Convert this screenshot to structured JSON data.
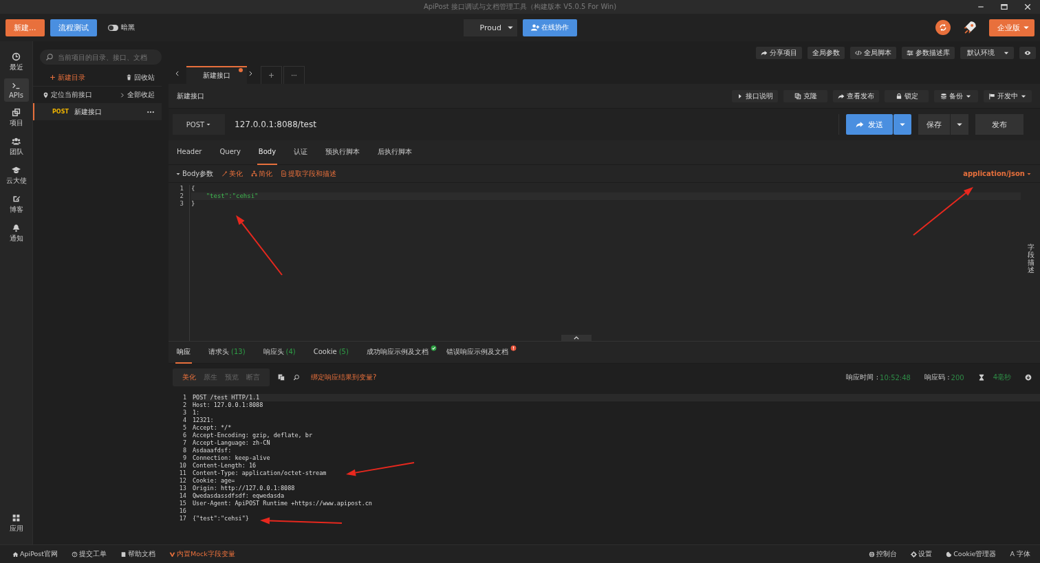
{
  "window": {
    "title": "ApiPost 接口调试与文档管理工具（构建版本 V5.0.5 For Win)"
  },
  "toolbar": {
    "new_button": "新建...",
    "flow_button": "流程测试",
    "dark_toggle": {
      "label": "暗黑",
      "on": false
    },
    "team_select": "Proud",
    "collab_button": "在线协作",
    "edition_button": "企业版"
  },
  "rail": [
    {
      "label": "最近",
      "kind": "clock",
      "selected": false
    },
    {
      "label": "APIs",
      "kind": "terminal",
      "selected": true
    },
    {
      "label": "项目",
      "kind": "windows",
      "selected": false
    },
    {
      "label": "团队",
      "kind": "users",
      "selected": false
    },
    {
      "label": "云大使",
      "kind": "cap",
      "selected": false
    },
    {
      "label": "博客",
      "kind": "edit",
      "selected": false
    },
    {
      "label": "通知",
      "kind": "bell",
      "selected": false
    }
  ],
  "rail_bottom": {
    "label": "应用",
    "kind": "grid"
  },
  "sidebar": {
    "search_placeholder": "当前项目的目录、接口、文档",
    "new_folder": "新建目录",
    "trash": "回收站",
    "locate": "定位当前接口",
    "collapse": "全部收起",
    "items": [
      {
        "method": "POST",
        "name": "新建接口",
        "selected": true
      }
    ]
  },
  "global_actions": [
    "分享项目",
    "全局参数",
    "全局脚本",
    "参数描述库"
  ],
  "environment": "默认环境",
  "tabs": [
    {
      "label": "新建接口",
      "selected": true,
      "unsaved": true
    }
  ],
  "api_name": "新建接口",
  "api_actions": [
    {
      "label": "接口说明",
      "kind": "play",
      "dropdown": false
    },
    {
      "label": "克隆",
      "kind": "copy",
      "dropdown": false
    },
    {
      "label": "查看发布",
      "kind": "share",
      "dropdown": false
    },
    {
      "label": "锁定",
      "kind": "lock",
      "dropdown": false
    },
    {
      "label": "备份",
      "kind": "db",
      "dropdown": true
    },
    {
      "label": "开发中",
      "kind": "flag",
      "dropdown": true
    }
  ],
  "request": {
    "method": "POST",
    "url": "127.0.0.1:8088/test",
    "send": "发送",
    "save": "保存",
    "publish": "发布"
  },
  "request_tabs": [
    {
      "label": "Header",
      "selected": false
    },
    {
      "label": "Query",
      "selected": false
    },
    {
      "label": "Body",
      "selected": true
    },
    {
      "label": "认证",
      "selected": false
    },
    {
      "label": "预执行脚本",
      "selected": false
    },
    {
      "label": "后执行脚本",
      "selected": false
    }
  ],
  "body_bar": {
    "label": "Body参数",
    "actions": [
      "美化",
      "简化",
      "提取字段和描述"
    ],
    "content_type": "application/json"
  },
  "body_lines": [
    {
      "no": "1",
      "text": "{",
      "kind": "plain"
    },
    {
      "no": "2",
      "text": "    \"test\":\"cehsi\"",
      "kind": "string"
    },
    {
      "no": "3",
      "text": "}",
      "kind": "plain"
    }
  ],
  "side_tab": "字段描述",
  "response_tabs": [
    {
      "label": "响应",
      "kind": "plain",
      "selected": true
    },
    {
      "label": "请求头",
      "count": "(13)",
      "kind": "plain",
      "selected": false
    },
    {
      "label": "响应头",
      "count": "(4)",
      "kind": "plain",
      "selected": false
    },
    {
      "label": "Cookie",
      "count": "(5)",
      "kind": "plain",
      "selected": false
    },
    {
      "label": "成功响应示例及文档",
      "kind": "ok",
      "selected": false
    },
    {
      "label": "错误响应示例及文档",
      "kind": "error",
      "selected": false
    }
  ],
  "view_modes": [
    {
      "label": "美化",
      "selected": true
    },
    {
      "label": "原生",
      "selected": false
    },
    {
      "label": "预览",
      "selected": false
    },
    {
      "label": "断言",
      "selected": false
    }
  ],
  "bind_link": "绑定响应结果到变量?",
  "response_meta": {
    "time_label": "响应时间 :",
    "time": "10:52:48",
    "code_label": "响应码 :",
    "code": "200",
    "duration": "4毫秒"
  },
  "response_lines": [
    {
      "no": "1",
      "text": "POST /test HTTP/1.1"
    },
    {
      "no": "2",
      "text": "Host: 127.0.0.1:8088"
    },
    {
      "no": "3",
      "text": "1:"
    },
    {
      "no": "4",
      "text": "12321:"
    },
    {
      "no": "5",
      "text": "Accept: */*"
    },
    {
      "no": "6",
      "text": "Accept-Encoding: gzip, deflate, br"
    },
    {
      "no": "7",
      "text": "Accept-Language: zh-CN"
    },
    {
      "no": "8",
      "text": "Asdaaafdsf:"
    },
    {
      "no": "9",
      "text": "Connection: keep-alive"
    },
    {
      "no": "10",
      "text": "Content-Length: 16"
    },
    {
      "no": "11",
      "text": "Content-Type: application/octet-stream"
    },
    {
      "no": "12",
      "text": "Cookie: age="
    },
    {
      "no": "13",
      "text": "Origin: http://127.0.0.1:8088"
    },
    {
      "no": "14",
      "text": "Qwedasdassdfsdf: eqwedasda"
    },
    {
      "no": "15",
      "text": "User-Agent: ApiPOST Runtime +https://www.apipost.cn"
    },
    {
      "no": "16"
    },
    {
      "no": "17",
      "text": "{\"test\":\"cehsi\"}"
    }
  ],
  "footer_left": [
    {
      "label": "ApiPost官网",
      "kind": "home",
      "accent": false
    },
    {
      "label": "提交工单",
      "kind": "help",
      "accent": false
    },
    {
      "label": "帮助文档",
      "kind": "book",
      "accent": false
    },
    {
      "label": "内置Mock字段变量",
      "kind": "v",
      "accent": true
    }
  ],
  "footer_right": [
    {
      "label": "控制台",
      "kind": "globe"
    },
    {
      "label": "设置",
      "kind": "gear"
    },
    {
      "label": "Cookie管理器",
      "kind": "cookie"
    },
    {
      "label": "A 字体",
      "kind": "text"
    }
  ]
}
